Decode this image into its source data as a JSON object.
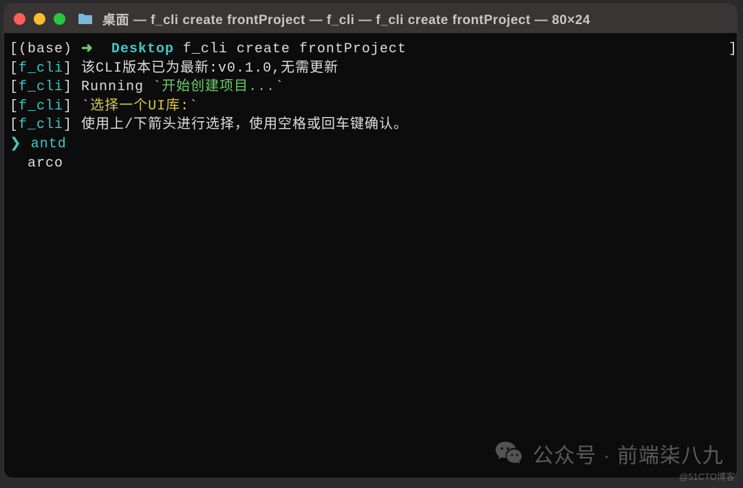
{
  "window": {
    "title": "桌面 — f_cli create frontProject — f_cli — f_cli create frontProject — 80×24"
  },
  "prompt": {
    "open_bracket": "[",
    "base": "(base)",
    "arrow": "➜",
    "location": "Desktop",
    "command": "f_cli create frontProject",
    "close_bracket": "]"
  },
  "lines": {
    "l1": {
      "open": "[",
      "tag": "f_cli",
      "close": "]",
      "text": " 该CLI版本已为最新:v0.1.0,无需更新"
    },
    "l2": {
      "open": "[",
      "tag": "f_cli",
      "close": "]",
      "running": " Running ",
      "bt1": "`",
      "action": "开始创建项目...",
      "bt2": "`"
    },
    "l3": {
      "open": "[",
      "tag": "f_cli",
      "close": "]",
      "sp": " ",
      "bt1": "`",
      "prompt": "选择一个UI库:",
      "bt2": "`"
    },
    "l4": {
      "open": "[",
      "tag": "f_cli",
      "close": "]",
      "text": " 使用上/下箭头进行选择，使用空格或回车键确认。"
    }
  },
  "selector": {
    "caret": "❯ ",
    "selected": "antd",
    "indent": "  ",
    "unselected": "arco"
  },
  "watermark": {
    "text": "公众号 · 前端柒八九"
  },
  "credit": "@51CTO博客"
}
